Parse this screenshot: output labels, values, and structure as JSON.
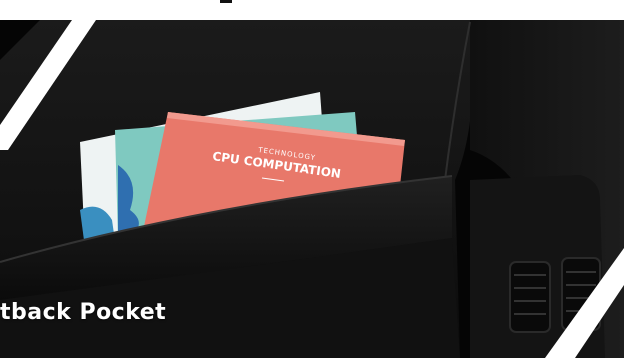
{
  "caption": {
    "text": "tback Pocket"
  },
  "booklet": {
    "kicker": "TECHNOLOGY",
    "title": "CPU COMPUTATION"
  },
  "colors": {
    "background": "#050505",
    "seat": "#151515",
    "booklet_front": "#e8786a",
    "booklet_teal": "#7fc9c0",
    "booklet_blue": "#2f6fb0",
    "stripe": "#ffffff"
  }
}
